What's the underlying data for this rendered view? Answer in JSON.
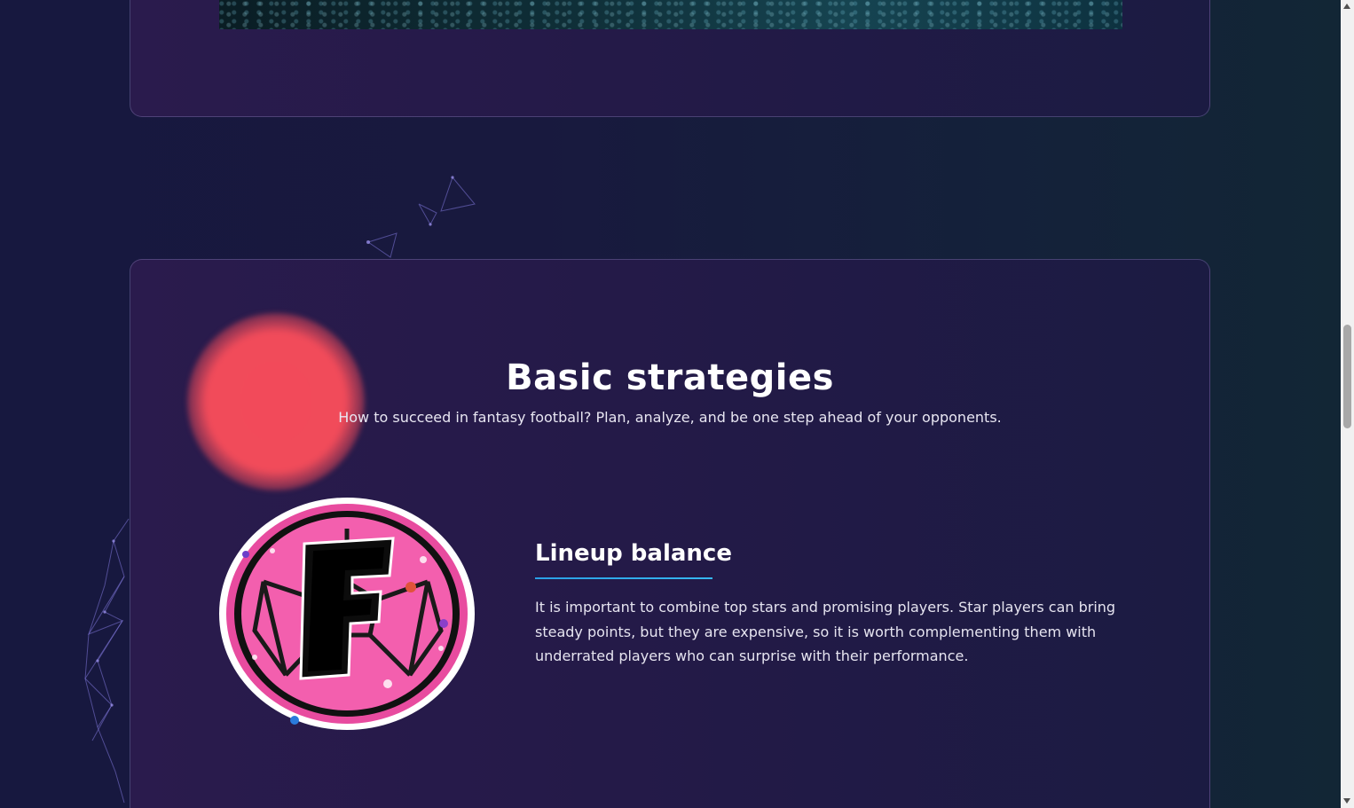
{
  "section": {
    "title": "Basic strategies",
    "subtitle": "How to succeed in fantasy football? Plan, analyze, and be one step ahead of your opponents."
  },
  "feature": {
    "title": "Lineup balance",
    "text": "It is important to combine top stars and promising players. Star players can bring steady points, but they are expensive, so it is worth complementing them with underrated players who can surprise with their performance.",
    "badge_letter": "F"
  },
  "colors": {
    "accent_underline": "#2aa0e6",
    "blob": "#f14b5a",
    "badge_pink": "#f15fb0"
  },
  "icons": {
    "badge": "football-f-badge-icon",
    "scroll_up": "scroll-up-arrow-icon",
    "scroll_down": "scroll-down-arrow-icon"
  }
}
